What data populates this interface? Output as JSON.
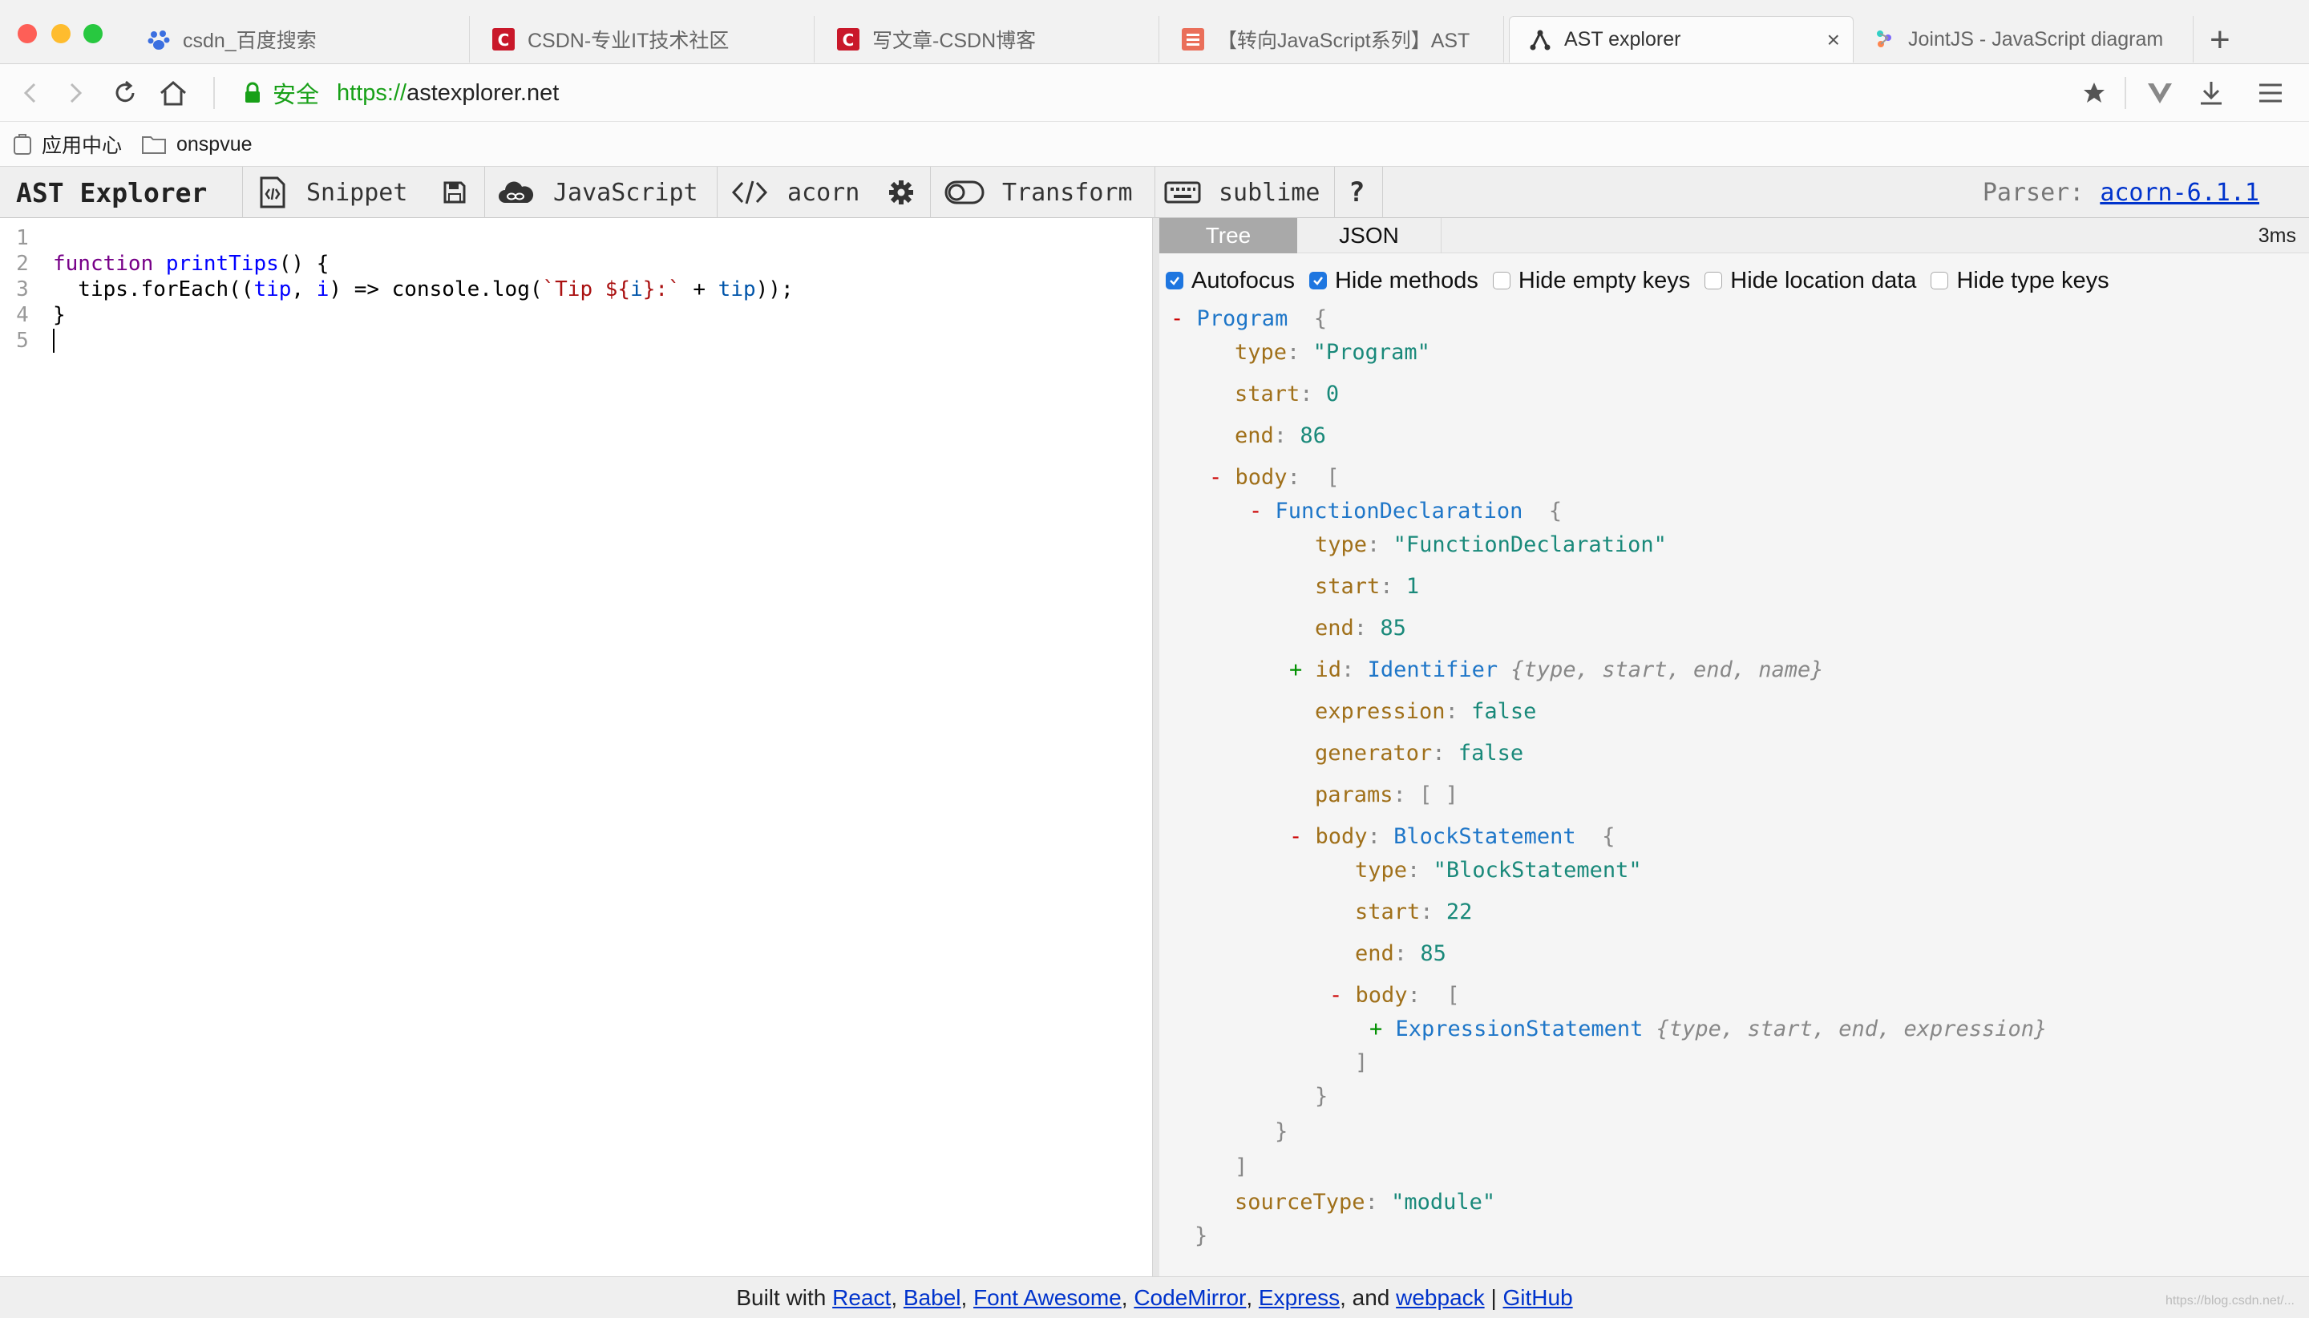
{
  "browser": {
    "colors": {
      "close": "#fe5f57",
      "minimize": "#febc2e",
      "maximize": "#28c840"
    },
    "tabs": [
      {
        "label": "csdn_百度搜索",
        "icon": "baidu-paw-icon"
      },
      {
        "label": "CSDN-专业IT技术社区",
        "icon": "csdn-logo-icon"
      },
      {
        "label": "写文章-CSDN博客",
        "icon": "csdn-logo-icon"
      },
      {
        "label": "【转向JavaScript系列】AST",
        "icon": "jianshu-logo-icon"
      },
      {
        "label": "AST explorer",
        "icon": "ast-tree-icon",
        "active": true
      },
      {
        "label": "JointJS - JavaScript diagram",
        "icon": "jointjs-logo-icon"
      }
    ],
    "new_tab": "+",
    "close_tab": "×",
    "address": {
      "secure_label": "安全",
      "scheme": "https://",
      "host": "astexplorer.net"
    },
    "bookmarks": [
      {
        "label": "应用中心",
        "icon": "apps-icon"
      },
      {
        "label": "onspvue",
        "icon": "folder-icon"
      }
    ]
  },
  "toolbar": {
    "brand": "AST Explorer",
    "snippet": "Snippet",
    "language": "JavaScript",
    "parser_name": "acorn",
    "transform": "Transform",
    "keymap": "sublime",
    "help": "?",
    "parser_label": "Parser:",
    "parser_version": "acorn-6.1.1"
  },
  "editor": {
    "line_numbers": [
      "1",
      "2",
      "3",
      "4",
      "5"
    ],
    "code": [
      "",
      "function printTips() {",
      "  tips.forEach((tip, i) => console.log(`Tip ${i}:` + tip));",
      "}",
      ""
    ]
  },
  "output": {
    "tabs": [
      "Tree",
      "JSON"
    ],
    "timing": "3ms",
    "options": [
      {
        "label": "Autofocus",
        "checked": true
      },
      {
        "label": "Hide methods",
        "checked": true
      },
      {
        "label": "Hide empty keys",
        "checked": false
      },
      {
        "label": "Hide location data",
        "checked": false
      },
      {
        "label": "Hide type keys",
        "checked": false
      }
    ],
    "tree": {
      "program": {
        "node": "Program",
        "type": "\"Program\"",
        "start": "0",
        "end": "86"
      },
      "body_key": "body",
      "func": {
        "node": "FunctionDeclaration",
        "type": "\"FunctionDeclaration\"",
        "start": "1",
        "end": "85"
      },
      "id": {
        "key": "id",
        "node": "Identifier",
        "summary": "{type, start, end, name}"
      },
      "expression": "false",
      "generator": "false",
      "params": "[ ]",
      "block": {
        "node": "BlockStatement",
        "type": "\"BlockStatement\"",
        "start": "22",
        "end": "85"
      },
      "stmt": {
        "node": "ExpressionStatement",
        "summary": "{type, start, end, expression}"
      },
      "source_type": "\"module\""
    }
  },
  "footer": {
    "prefix": "Built with",
    "links": [
      "React",
      "Babel",
      "Font Awesome",
      "CodeMirror",
      "Express",
      "webpack",
      "GitHub"
    ],
    "and": "and",
    "sep": "|"
  },
  "watermark": "https://blog.csdn.net/..."
}
